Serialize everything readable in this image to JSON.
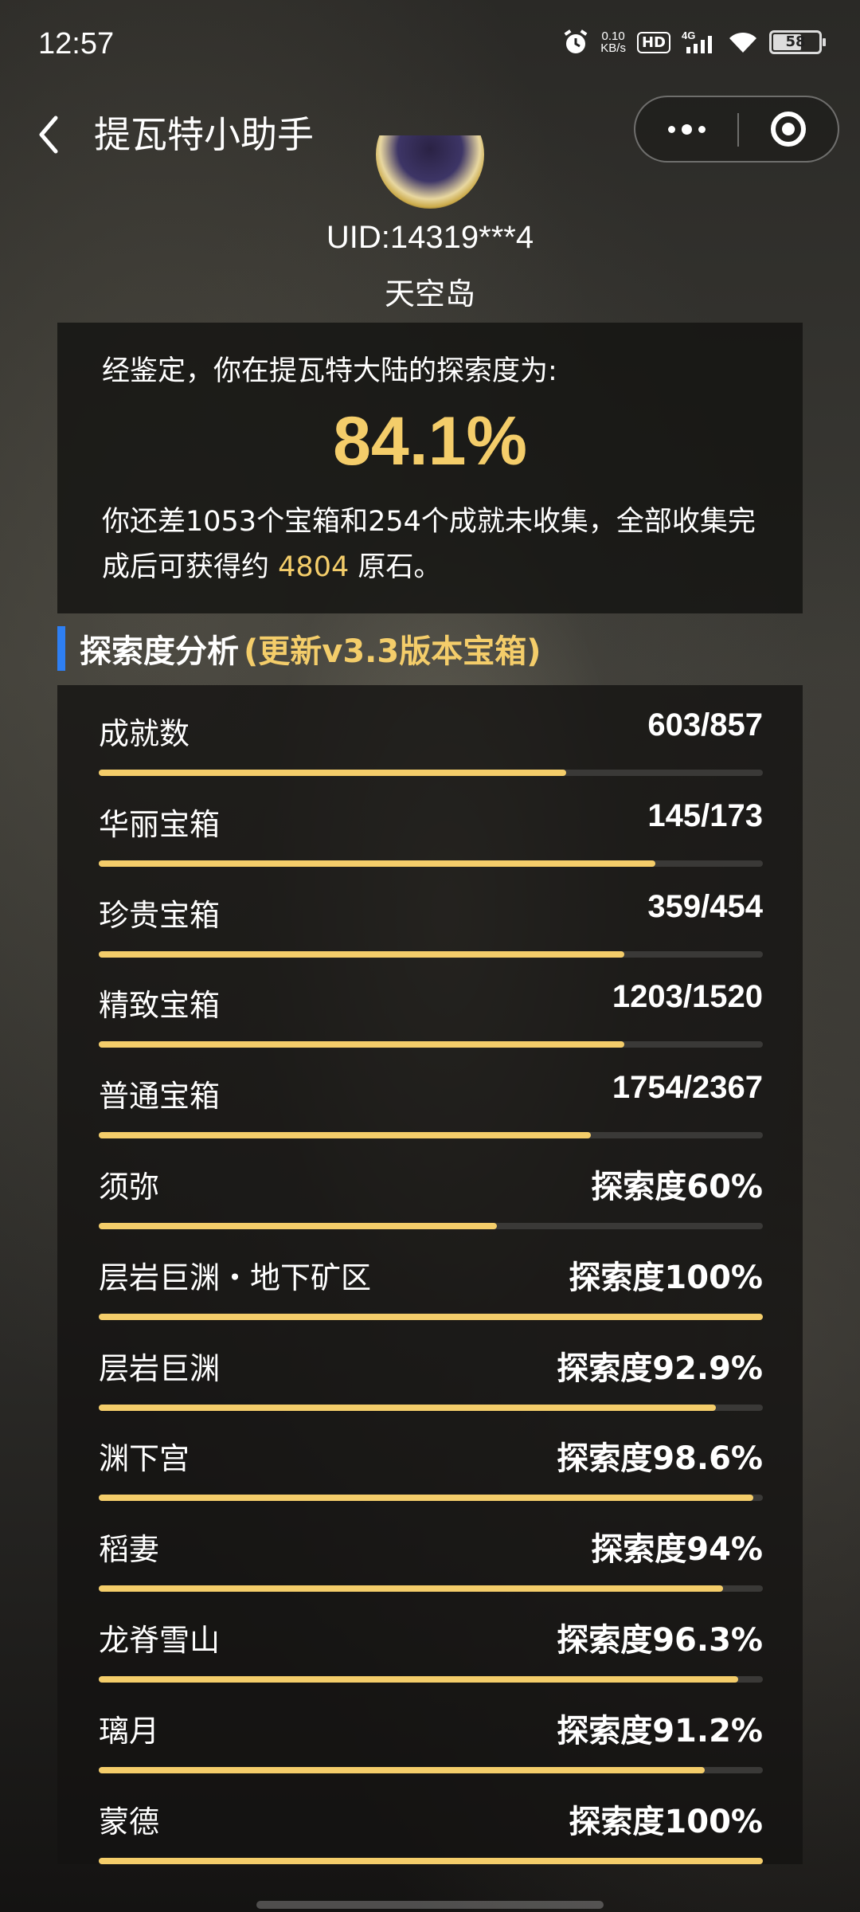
{
  "status_bar": {
    "time": "12:57",
    "net_speed_top": "0.10",
    "net_speed_bottom": "KB/s",
    "hd": "HD",
    "signal": "4G",
    "battery": "58"
  },
  "navbar": {
    "title": "提瓦特小助手"
  },
  "profile": {
    "uid": "UID:14319***4",
    "server": "天空岛"
  },
  "summary": {
    "intro": "经鉴定，你在提瓦特大陆的探索度为:",
    "percent": "84.1%",
    "desc_prefix": "你还差1053个宝箱和254个成就未收集，全部收集完成后可获得约",
    "primogems": "4804",
    "desc_suffix": "原石。"
  },
  "section": {
    "title": "探索度分析",
    "subtitle": "(更新v3.3版本宝箱)"
  },
  "items": [
    {
      "label": "成就数",
      "value": "603/857",
      "progress": 0.704
    },
    {
      "label": "华丽宝箱",
      "value": "145/173",
      "progress": 0.838
    },
    {
      "label": "珍贵宝箱",
      "value": "359/454",
      "progress": 0.791
    },
    {
      "label": "精致宝箱",
      "value": "1203/1520",
      "progress": 0.791
    },
    {
      "label": "普通宝箱",
      "value": "1754/2367",
      "progress": 0.741
    },
    {
      "label": "须弥",
      "value": "探索度60%",
      "progress": 0.6
    },
    {
      "label": "层岩巨渊・地下矿区",
      "value": "探索度100%",
      "progress": 1.0
    },
    {
      "label": "层岩巨渊",
      "value": "探索度92.9%",
      "progress": 0.929
    },
    {
      "label": "渊下宫",
      "value": "探索度98.6%",
      "progress": 0.986
    },
    {
      "label": "稻妻",
      "value": "探索度94%",
      "progress": 0.94
    },
    {
      "label": "龙脊雪山",
      "value": "探索度96.3%",
      "progress": 0.963
    },
    {
      "label": "璃月",
      "value": "探索度91.2%",
      "progress": 0.912
    },
    {
      "label": "蒙德",
      "value": "探索度100%",
      "progress": 1.0
    }
  ]
}
